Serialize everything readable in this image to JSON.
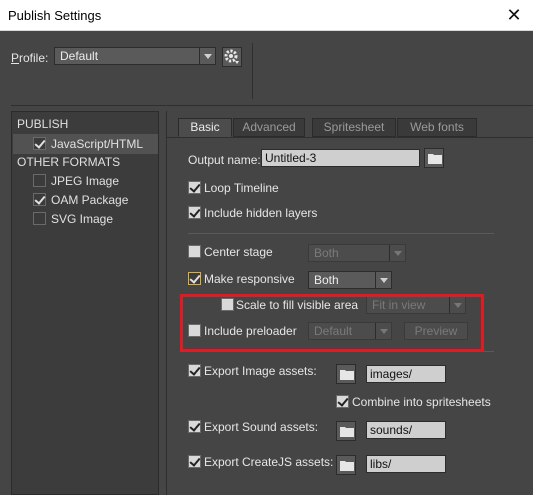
{
  "window": {
    "title": "Publish Settings",
    "close_glyph": "✕"
  },
  "profile": {
    "label": "Profile:",
    "value": "Default",
    "settings_icon": "gear-icon"
  },
  "left_panel": {
    "publish_heading": "PUBLISH",
    "publish_items": [
      {
        "label": "JavaScript/HTML",
        "checked": true,
        "selected": true
      }
    ],
    "other_heading": "OTHER FORMATS",
    "other_items": [
      {
        "label": "JPEG Image",
        "checked": false
      },
      {
        "label": "OAM Package",
        "checked": true
      },
      {
        "label": "SVG Image",
        "checked": false
      }
    ]
  },
  "tabs": [
    {
      "label": "Basic",
      "active": true
    },
    {
      "label": "Advanced",
      "active": false
    },
    {
      "label": "Spritesheet",
      "active": false
    },
    {
      "label": "Web fonts",
      "active": false
    }
  ],
  "basic": {
    "output_name_label": "Output name:",
    "output_name_value": "Untitled-3",
    "loop_timeline": {
      "label": "Loop Timeline",
      "checked": true
    },
    "include_hidden_layers": {
      "label": "Include hidden layers",
      "checked": true
    },
    "center_stage": {
      "label": "Center stage",
      "checked": false,
      "dropdown": "Both"
    },
    "make_responsive": {
      "label": "Make responsive",
      "checked": true,
      "dropdown": "Both"
    },
    "scale_to_fill": {
      "label": "Scale to fill visible area",
      "checked": false,
      "dropdown": "Fit in view"
    },
    "include_preloader": {
      "label": "Include preloader",
      "checked": false,
      "dropdown": "Default",
      "preview_label": "Preview"
    },
    "export_image": {
      "label": "Export Image assets:",
      "checked": true,
      "path": "images/"
    },
    "combine_spritesheets": {
      "label": "Combine into spritesheets",
      "checked": true
    },
    "export_sound": {
      "label": "Export Sound assets:",
      "checked": true,
      "path": "sounds/"
    },
    "export_createjs": {
      "label": "Export CreateJS assets:",
      "checked": true,
      "path": "libs/"
    }
  },
  "highlight_color": "#e01b24"
}
